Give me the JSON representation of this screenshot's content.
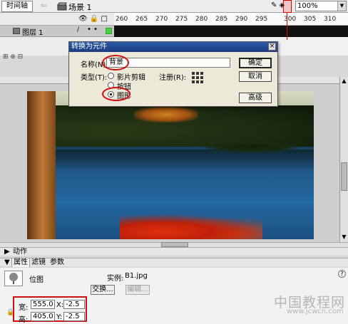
{
  "toolbar": {
    "timeline_tab": "时间轴",
    "scene_label": "场景 1",
    "zoom_value": "100%"
  },
  "timeline": {
    "ruler_ticks": [
      "260",
      "265",
      "270",
      "275",
      "280",
      "285",
      "290",
      "295",
      "300",
      "305",
      "310"
    ],
    "layer_name": "图层 1"
  },
  "dialog": {
    "title": "转换为元件",
    "name_label": "名称(N):",
    "name_value": "背景",
    "type_label": "类型(T):",
    "type_options": [
      "影片剪辑",
      "按钮",
      "图形"
    ],
    "selected_type": "图形",
    "registration_label": "注册(R):",
    "ok_button": "确定",
    "cancel_button": "取消",
    "advanced_button": "高级",
    "close_glyph": "×"
  },
  "panels": {
    "actions_label": "动作",
    "tabs": [
      "属性",
      "滤镜",
      "参数"
    ],
    "bitmap_label": "位图",
    "instance_label": "实例:",
    "instance_value": "B1.jpg",
    "swap_button": "交换...",
    "edit_button": "编辑...",
    "width_label": "宽:",
    "width_value": "555.0",
    "x_label": "X:",
    "x_value": "-2.5",
    "height_label": "高:",
    "height_value": "405.0",
    "y_label": "Y:",
    "y_value": "-2.5",
    "help_glyph": "?"
  },
  "watermark": {
    "text": "中国教程网",
    "url": "www.jcwcn.com"
  },
  "colors": {
    "highlight": "#d01010",
    "dialog_title_bg": "#2a5aa8",
    "frames_bg": "#111111",
    "layer_color": "#4ad04a"
  }
}
